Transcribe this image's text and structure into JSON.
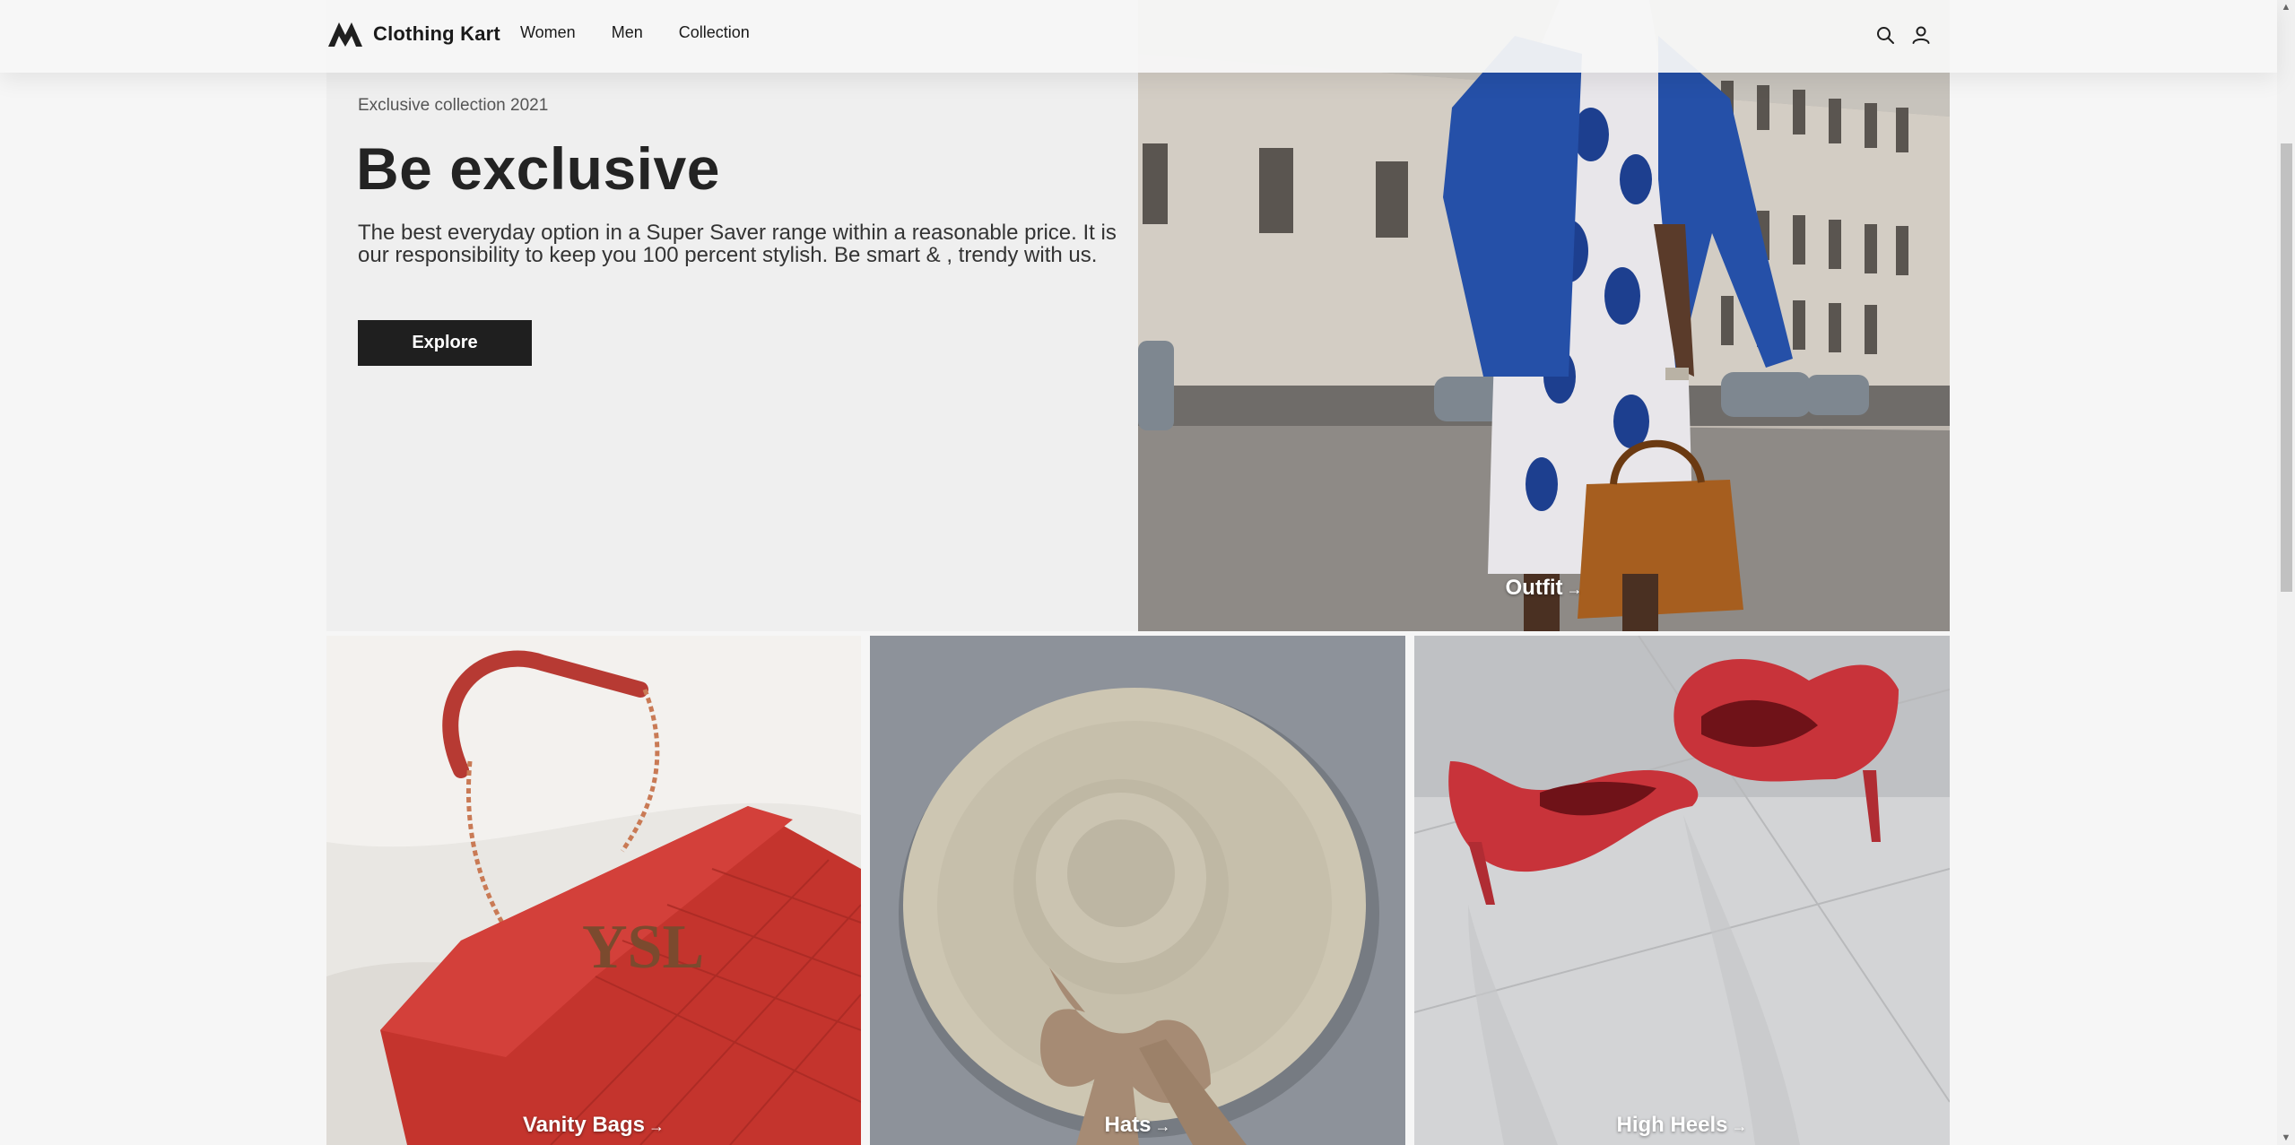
{
  "header": {
    "brand": "Clothing Kart",
    "logo_icon": "m-logo-icon",
    "nav": [
      {
        "label": "Women"
      },
      {
        "label": "Men"
      },
      {
        "label": "Collection"
      }
    ],
    "icons": [
      "search-icon",
      "user-icon"
    ]
  },
  "hero": {
    "eyebrow": "Exclusive collection 2021",
    "title": "Be exclusive",
    "description": "The best everyday option in a Super Saver range within a reasonable price. It is our responsibility to keep you 100 percent stylish. Be smart & , trendy with us.",
    "button": "Explore"
  },
  "categories": {
    "outfit": {
      "label": "Outfit",
      "arrow": "→"
    },
    "vanity": {
      "label": "Vanity Bags",
      "arrow": "→"
    },
    "hats": {
      "label": "Hats",
      "arrow": "→"
    },
    "heels": {
      "label": "High Heels",
      "arrow": "→"
    }
  },
  "scrollbar": {
    "up": "▲",
    "down": "▼"
  },
  "colors": {
    "background": "#f6f6f6",
    "hero_panel": "#efefef",
    "button": "#1f1f1f",
    "text": "#1f1f1f"
  }
}
